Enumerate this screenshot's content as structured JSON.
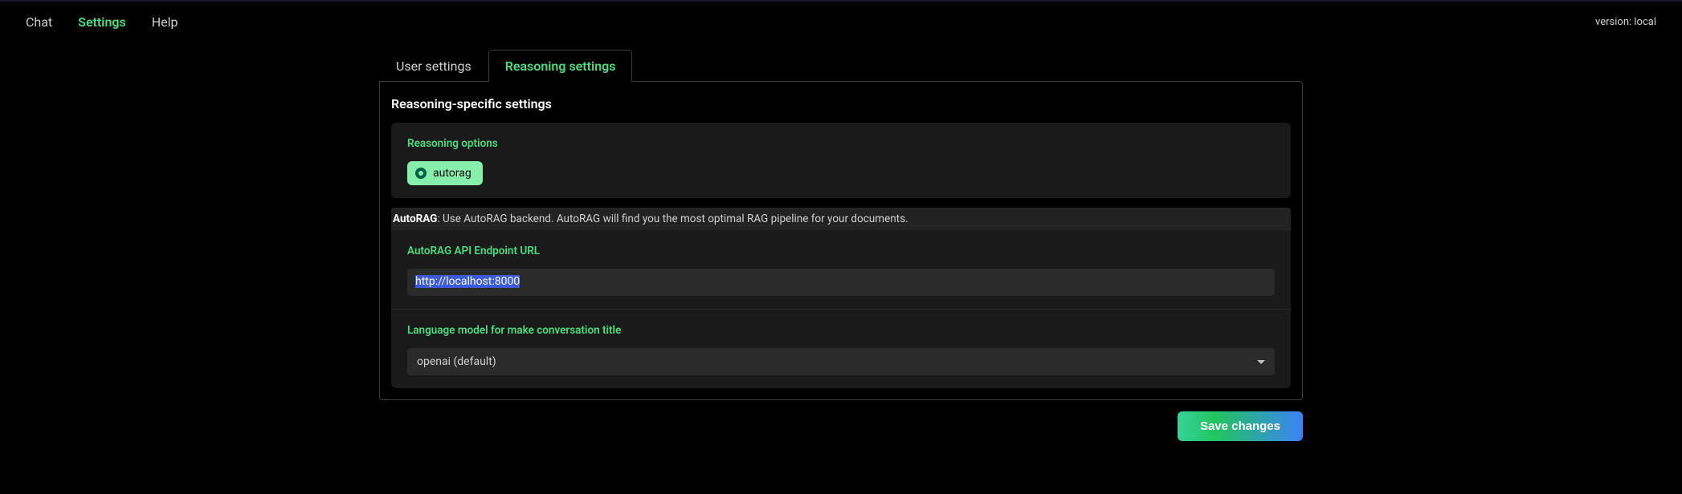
{
  "header": {
    "nav": {
      "chat": "Chat",
      "settings": "Settings",
      "help": "Help"
    },
    "version_label": "version: local"
  },
  "tabs": {
    "user_settings": "User settings",
    "reasoning_settings": "Reasoning settings"
  },
  "panel": {
    "title": "Reasoning-specific settings",
    "reasoning_options": {
      "label": "Reasoning options",
      "chip_autorag": "autorag"
    },
    "autorag_desc": {
      "bold": "AutoRAG",
      "rest": ": Use AutoRAG backend. AutoRAG will find you the most optimal RAG pipeline for your documents."
    },
    "endpoint": {
      "label": "AutoRAG API Endpoint URL",
      "value": "http://localhost:8000"
    },
    "llm_title": {
      "label": "Language model for make conversation title",
      "selected": "openai (default)"
    }
  },
  "footer": {
    "save_label": "Save changes"
  }
}
